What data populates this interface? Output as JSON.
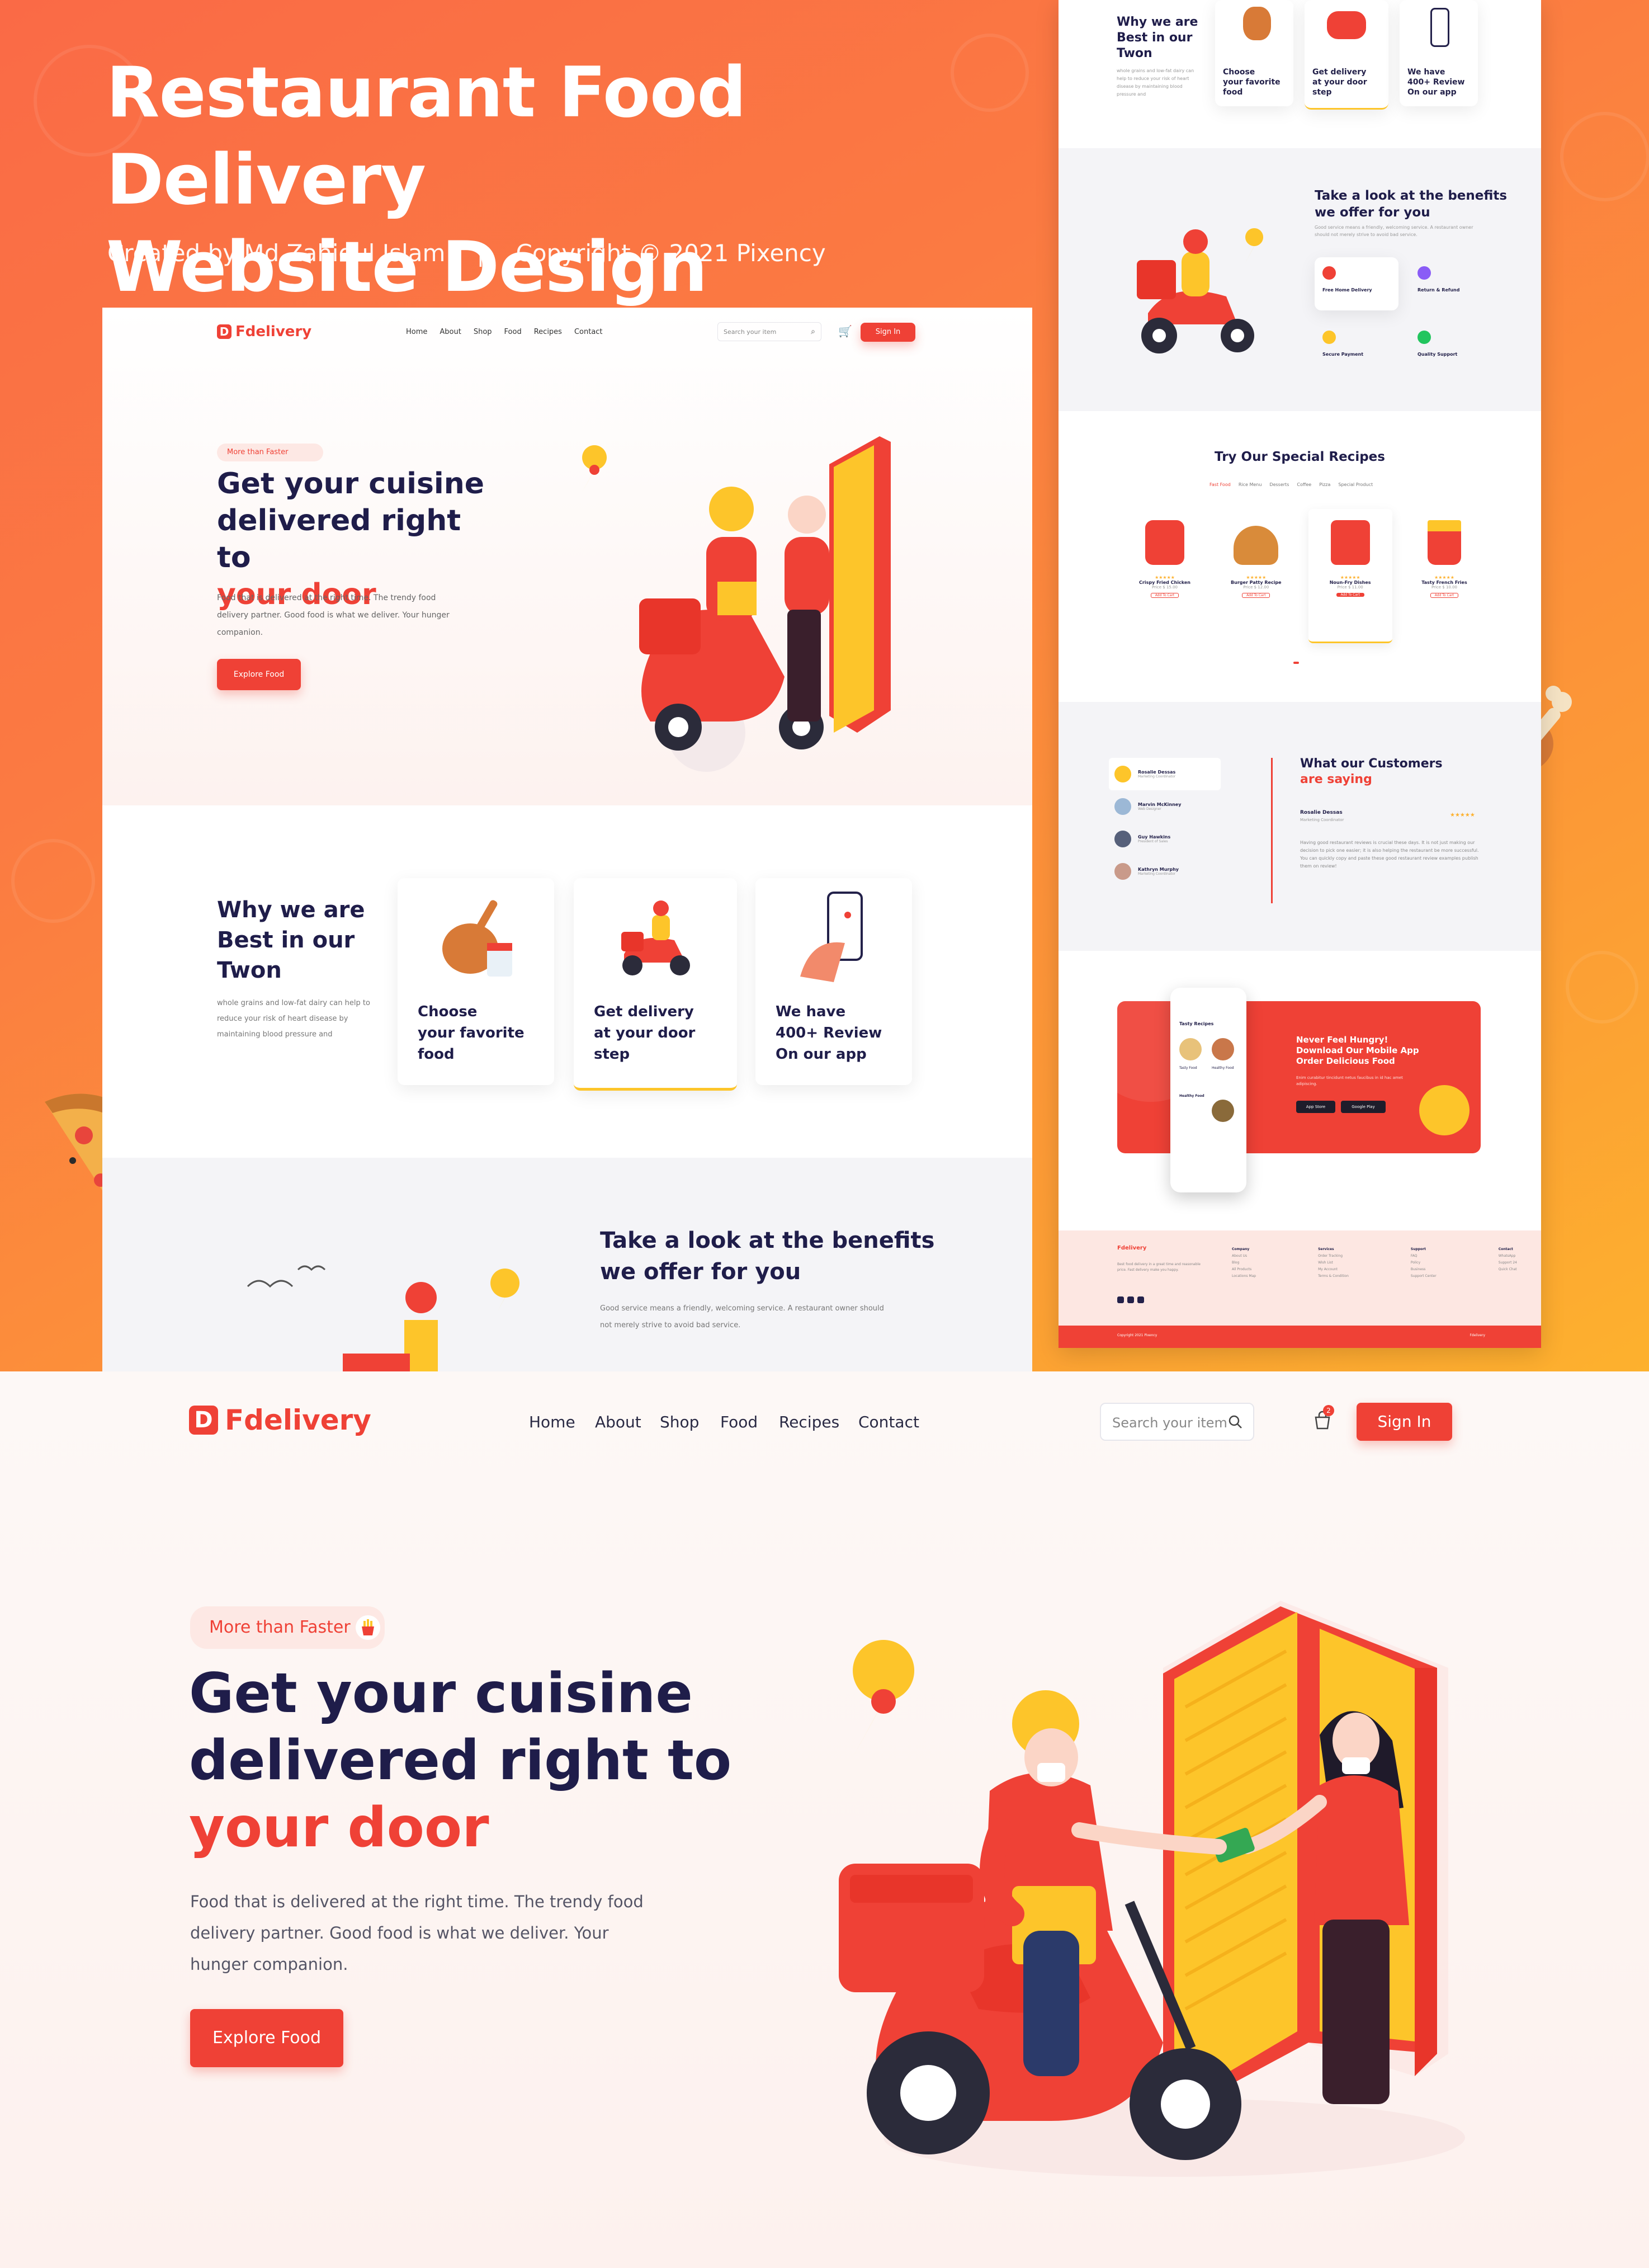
{
  "presentation": {
    "title_line1": "Restaurant Food Delivery",
    "title_line2": "Website Design",
    "credit": "Created by Md Zahidul Islam",
    "separator": "|",
    "copyright": "Copyright © 2021 Pixency"
  },
  "brand": {
    "logo_letter": "D",
    "name": "Fdelivery",
    "accent": "#ef4136",
    "secondary": "#fdc52a"
  },
  "nav": {
    "items": [
      "Home",
      "About",
      "Shop",
      "Food",
      "Recipes",
      "Contact"
    ],
    "search_placeholder": "Search your item",
    "cart_count": "2",
    "signin": "Sign In"
  },
  "hero": {
    "pill": "More than Faster",
    "heading_line1": "Get your cuisine",
    "heading_line2": "delivered right to",
    "heading_line3": "your door",
    "desc": "Food that is delivered at the right time. The trendy food delivery partner. Good food is what we deliver. Your hunger companion.",
    "button": "Explore Food"
  },
  "why": {
    "title_line1": "Why we are",
    "title_line2": "Best in our",
    "title_line3": "Twon",
    "desc": "whole grains and low-fat dairy can help to reduce your risk of heart disease by maintaining blood pressure and",
    "cards": [
      {
        "line1": "Choose",
        "line2": "your favorite",
        "line3": "food"
      },
      {
        "line1": "Get delivery",
        "line2": "at your door",
        "line3": "step"
      },
      {
        "line1": "We have",
        "line2": "400+ Review",
        "line3": "On our app"
      }
    ]
  },
  "benefits": {
    "title_line1": "Take a look at the benefits",
    "title_line2": "we offer for you",
    "desc": "Good service means a friendly, welcoming service. A restaurant owner should not merely strive to avoid bad service.",
    "items": [
      "Free Home Delivery",
      "Return & Refund",
      "Secure Payment",
      "Quality Support"
    ]
  },
  "recipes": {
    "title": "Try Our Special Recipes",
    "tabs": [
      "Fast Food",
      "Rice Menu",
      "Desserts",
      "Coffee",
      "Pizza",
      "Special Product"
    ],
    "items": [
      {
        "name": "Crispy Fried Chicken",
        "price": "Price $ 15.00",
        "button": "Add To Cart"
      },
      {
        "name": "Burger Patty Recipe",
        "price": "Price $ 12.00",
        "button": "Add To Cart"
      },
      {
        "name": "Noun-Fry Dishes",
        "price": "Price $ 11.00",
        "button": "Add To Cart"
      },
      {
        "name": "Tasty French Fries",
        "price": "Price $ 10.00",
        "button": "Add To Cart"
      }
    ],
    "stars": "★★★★★"
  },
  "testimonials": {
    "title_line1": "What our Customers",
    "title_line2": "are saying",
    "people": [
      {
        "name": "Rosalie Dessas",
        "role": "Marketing Coordinator"
      },
      {
        "name": "Marvin McKinney",
        "role": "Web Designer"
      },
      {
        "name": "Guy Hawkins",
        "role": "President of Sales"
      },
      {
        "name": "Kathryn Murphy",
        "role": "Marketing Coordinator"
      }
    ],
    "active_name": "Rosalie Dessas",
    "active_role": "Marketing Coordinator",
    "quote": "Having good restaurant reviews is crucial these days. It is not just making our decision to pick one easier; it is also helping the restaurant be more successful. You can quickly copy and paste these good restaurant review examples publish them on review!",
    "stars": "★★★★★"
  },
  "app": {
    "title_line1": "Never Feel Hungry!",
    "title_line2": "Download Our Mobile App",
    "title_line3": "Order Delicious Food",
    "desc": "Enim curabitur tincidunt netus faucibus in id hac amet adipiscing.",
    "store1": "App Store",
    "store2": "Google Play",
    "phone_title": "Tasty Recipes",
    "phone_item1": "Tasty Food",
    "phone_item2": "Healthy Food",
    "phone_item3": "Healthy Food"
  },
  "footer": {
    "columns": [
      {
        "title": "Company",
        "links": [
          "About Us",
          "Blog",
          "All Products",
          "Locations Map"
        ]
      },
      {
        "title": "Services",
        "links": [
          "Order Tracking",
          "Wish List",
          "My Account",
          "Terms & Condition"
        ]
      },
      {
        "title": "Support",
        "links": [
          "FAQ",
          "Policy",
          "Business",
          "Support Center"
        ]
      },
      {
        "title": "Contact",
        "links": [
          "WhatsApp",
          "Support 24",
          "Quick Chat"
        ]
      }
    ],
    "about": "Best food delivery in a great time and reasonable price. Fast delivery make you happy.",
    "copyright": "Copyright 2021 Pixency",
    "tagline": "Fdelivery"
  }
}
